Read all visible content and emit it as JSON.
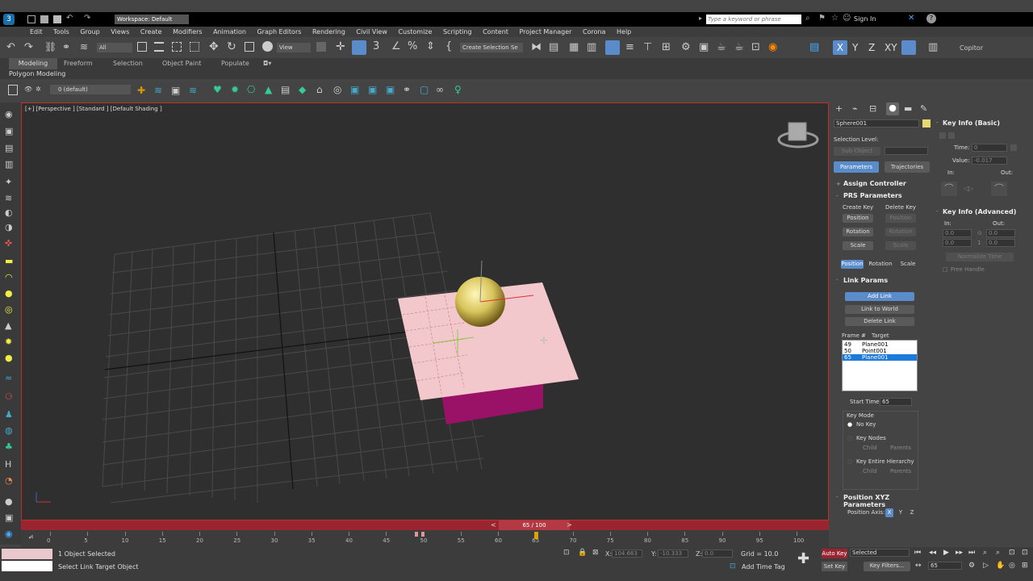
{
  "title_bar": {
    "workspace": "Workspace: Default",
    "search_placeholder": "Type a keyword or phrase",
    "signin": "Sign In"
  },
  "menu": [
    "Edit",
    "Tools",
    "Group",
    "Views",
    "Create",
    "Modifiers",
    "Animation",
    "Graph Editors",
    "Rendering",
    "Civil View",
    "Customize",
    "Scripting",
    "Content",
    "Project Manager",
    "Corona",
    "Help"
  ],
  "toolbar": {
    "filter": "All",
    "view": "View",
    "selection_set": "Create Selection Se",
    "axes": [
      "X",
      "Y",
      "Z",
      "XY"
    ],
    "copitor": "Copitor"
  },
  "ribbon_tabs": [
    "Modeling",
    "Freeform",
    "Selection",
    "Object Paint",
    "Populate"
  ],
  "ribbon_sub": "Polygon Modeling",
  "layer": "0 (default)",
  "viewport_label": "[+] [Perspective ] [Standard ] [Default Shading ]",
  "object_name": "Sphere001",
  "command_panel": {
    "selection_level": "Selection Level:",
    "sub_object": "Sub-Object",
    "parameters": "Parameters",
    "trajectories": "Trajectories",
    "assign_controller": "Assign Controller",
    "prs_parameters": "PRS Parameters",
    "create_key": "Create Key",
    "delete_key": "Delete Key",
    "position": "Position",
    "rotation": "Rotation",
    "scale": "Scale",
    "link_params": "Link Params",
    "add_link": "Add Link",
    "link_to_world": "Link to World",
    "delete_link": "Delete Link",
    "frame_col": "Frame #",
    "target_col": "Target",
    "links": [
      {
        "frame": "49",
        "target": "Plane001"
      },
      {
        "frame": "50",
        "target": "Point001"
      },
      {
        "frame": "65",
        "target": "Plane001"
      }
    ],
    "start_time_label": "Start Time:",
    "start_time": "65",
    "key_mode": "Key Mode",
    "no_key": "No Key",
    "key_nodes": "Key Nodes",
    "child": "Child",
    "parents": "Parents",
    "key_entire": "Key Entire Hierarchy",
    "pos_xyz": "Position XYZ Parameters",
    "pos_axis": "Position Axis:",
    "axis_x": "X",
    "axis_y": "Y",
    "axis_z": "Z"
  },
  "key_info": {
    "basic": "Key Info (Basic)",
    "time_label": "Time:",
    "time_val": "0",
    "value_label": "Value:",
    "value_val": "-0.017",
    "in": "In:",
    "out": "Out:",
    "advanced": "Key Info (Advanced)",
    "adv_vals": [
      "0.0",
      "0.0",
      "0.0",
      "0.0"
    ],
    "adv_mid": "1",
    "normalize": "Normalize Time",
    "free_handle": "Free Handle"
  },
  "timeline": {
    "frame": "65 / 100",
    "ticks": [
      "0",
      "5",
      "10",
      "15",
      "20",
      "25",
      "30",
      "35",
      "40",
      "45",
      "50",
      "55",
      "60",
      "65",
      "70",
      "75",
      "80",
      "85",
      "90",
      "95",
      "100"
    ]
  },
  "status": {
    "objects": "1 Object Selected",
    "prompt": "Select Link Target Object",
    "x_label": "X:",
    "x_val": "104.663",
    "y_label": "Y:",
    "y_val": "-10.333",
    "z_label": "Z:",
    "z_val": "0.0",
    "grid": "Grid = 10.0",
    "add_time_tag": "Add Time Tag",
    "auto_key": "Auto Key",
    "selected": "Selected",
    "set_key": "Set Key",
    "key_filters": "Key Filters...",
    "frame_field": "65"
  },
  "colors": {
    "accent": "#5a8ccc",
    "timebar": "#9a2530",
    "plane": "#f2c8cc",
    "box": "#9a1268",
    "sphere": "#e8d870"
  }
}
